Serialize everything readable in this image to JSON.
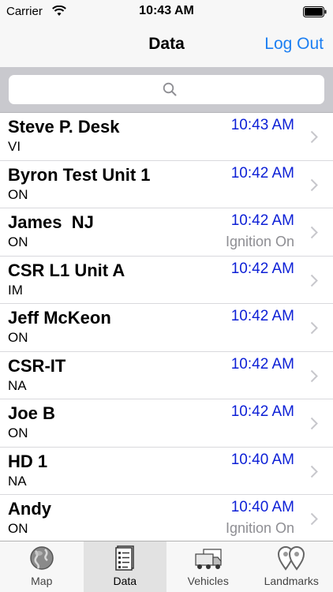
{
  "status_bar": {
    "carrier": "Carrier",
    "time": "10:43 AM"
  },
  "nav": {
    "title": "Data",
    "logout": "Log Out"
  },
  "search": {
    "placeholder": ""
  },
  "rows": [
    {
      "name": "Steve P. Desk",
      "status": "VI",
      "time": "10:43 AM",
      "detail": ""
    },
    {
      "name": "Byron Test Unit 1",
      "status": "ON",
      "time": "10:42 AM",
      "detail": ""
    },
    {
      "name": "James  NJ",
      "status": "ON",
      "time": "10:42 AM",
      "detail": "Ignition On"
    },
    {
      "name": "CSR L1 Unit A",
      "status": "IM",
      "time": "10:42 AM",
      "detail": ""
    },
    {
      "name": "Jeff McKeon",
      "status": "ON",
      "time": "10:42 AM",
      "detail": ""
    },
    {
      "name": "CSR-IT",
      "status": "NA",
      "time": "10:42 AM",
      "detail": ""
    },
    {
      "name": "Joe B",
      "status": "ON",
      "time": "10:42 AM",
      "detail": ""
    },
    {
      "name": "HD 1",
      "status": "NA",
      "time": "10:40 AM",
      "detail": ""
    },
    {
      "name": "Andy",
      "status": "ON",
      "time": "10:40 AM",
      "detail": "Ignition On"
    }
  ],
  "tabs": [
    {
      "label": "Map",
      "icon": "globe-icon",
      "selected": false
    },
    {
      "label": "Data",
      "icon": "document-list-icon",
      "selected": true
    },
    {
      "label": "Vehicles",
      "icon": "trucks-icon",
      "selected": false
    },
    {
      "label": "Landmarks",
      "icon": "landmark-pins-icon",
      "selected": false
    }
  ],
  "colors": {
    "accent": "#1c7ff2",
    "time_text": "#0c1fd6",
    "detail_text": "#8e8e93"
  }
}
